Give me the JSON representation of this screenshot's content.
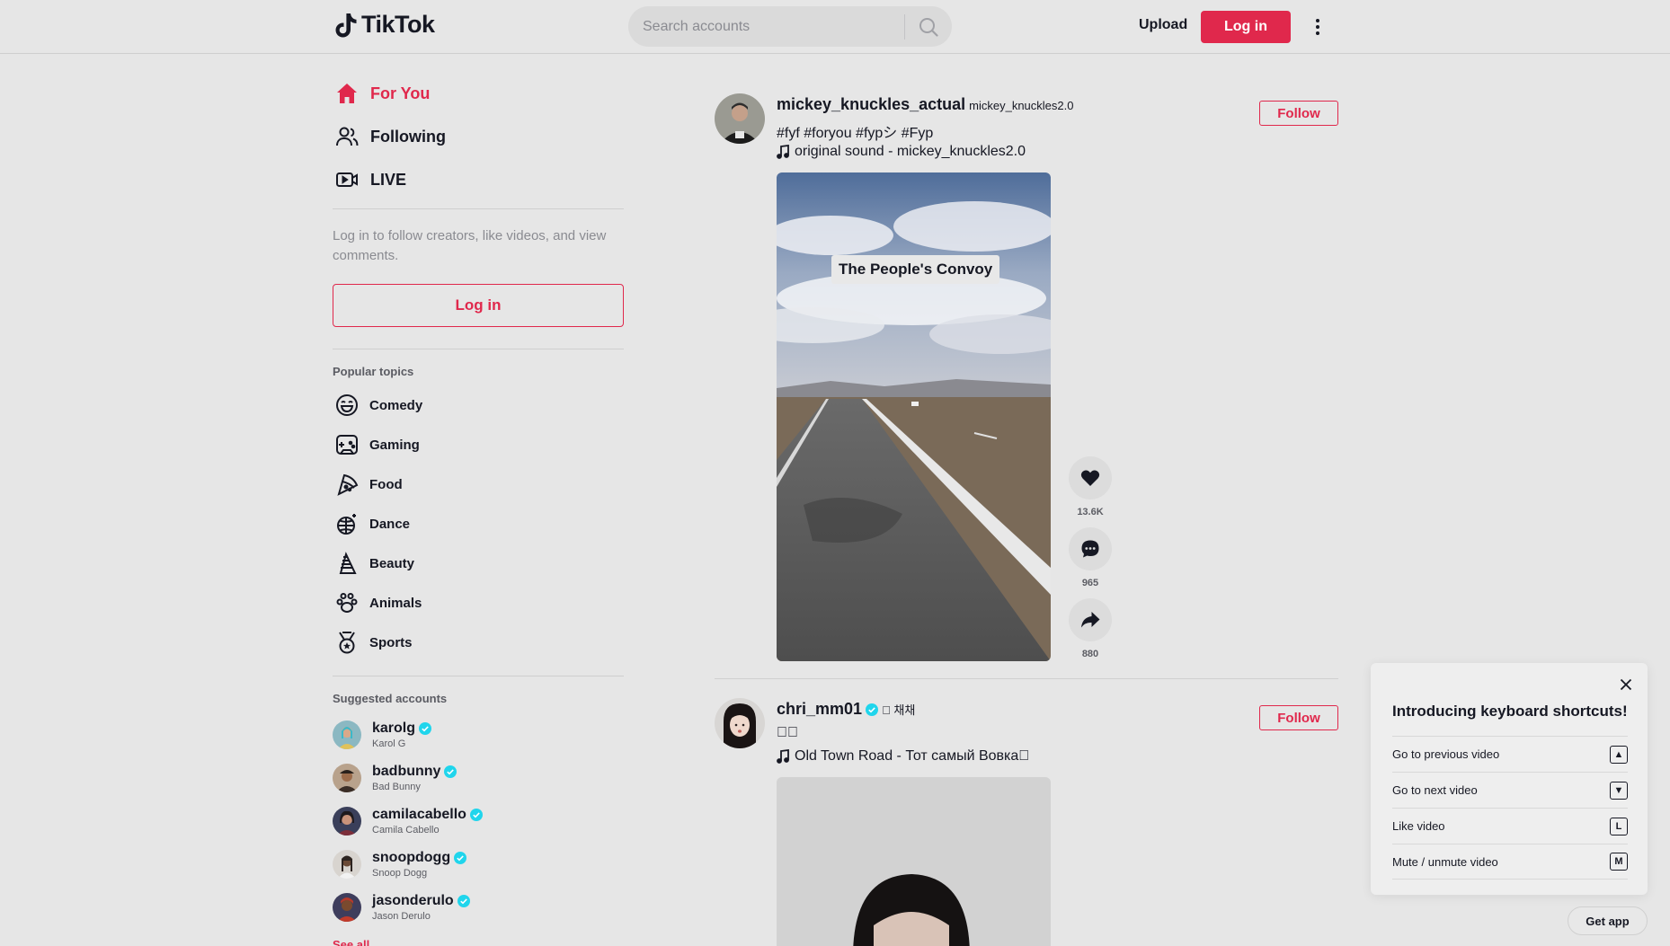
{
  "header": {
    "logo_text": "TikTok",
    "search_placeholder": "Search accounts",
    "upload_label": "Upload",
    "login_label": "Log in"
  },
  "sidebar": {
    "nav": [
      {
        "label": "For You",
        "icon": "home-icon",
        "active": true
      },
      {
        "label": "Following",
        "icon": "users-icon",
        "active": false
      },
      {
        "label": "LIVE",
        "icon": "live-icon",
        "active": false
      }
    ],
    "login_prompt": "Log in to follow creators, like videos, and view comments.",
    "login_label": "Log in",
    "topics_title": "Popular topics",
    "topics": [
      {
        "label": "Comedy",
        "icon": "smile-icon"
      },
      {
        "label": "Gaming",
        "icon": "gamepad-icon"
      },
      {
        "label": "Food",
        "icon": "pizza-icon"
      },
      {
        "label": "Dance",
        "icon": "disco-ball-icon"
      },
      {
        "label": "Beauty",
        "icon": "comb-icon"
      },
      {
        "label": "Animals",
        "icon": "paw-icon"
      },
      {
        "label": "Sports",
        "icon": "medal-icon"
      }
    ],
    "suggested_title": "Suggested accounts",
    "accounts": [
      {
        "user": "karolg",
        "name": "Karol G",
        "verified": true
      },
      {
        "user": "badbunny",
        "name": "Bad Bunny",
        "verified": true
      },
      {
        "user": "camilacabello",
        "name": "Camila Cabello",
        "verified": true
      },
      {
        "user": "snoopdogg",
        "name": "Snoop Dogg",
        "verified": true
      },
      {
        "user": "jasonderulo",
        "name": "Jason Derulo",
        "verified": true
      }
    ],
    "see_all": "See all"
  },
  "posts": [
    {
      "user": "mickey_knuckles_actual",
      "nick": "mickey_knuckles2.0",
      "caption": "#fyf #foryou #fypシ #Fyp",
      "music": "original sound - mickey_knuckles2.0",
      "follow_label": "Follow",
      "video_overlay": "The People's Convoy",
      "likes": "13.6K",
      "comments": "965",
      "shares": "880"
    },
    {
      "user": "chri_mm01",
      "nick": "\u0000 채채",
      "caption": "\u0000\u0000",
      "music": "Old Town Road - Тот самый Вовка\u0000",
      "follow_label": "Follow"
    }
  ],
  "shortcuts": {
    "title": "Introducing keyboard shortcuts!",
    "items": [
      {
        "label": "Go to previous video",
        "key": "▲"
      },
      {
        "label": "Go to next video",
        "key": "▼"
      },
      {
        "label": "Like video",
        "key": "L"
      },
      {
        "label": "Mute / unmute video",
        "key": "M"
      }
    ]
  },
  "get_app": "Get app",
  "colors": {
    "brand": "#e0284c",
    "background": "#e6e6e6",
    "verified": "#20d5ec"
  }
}
